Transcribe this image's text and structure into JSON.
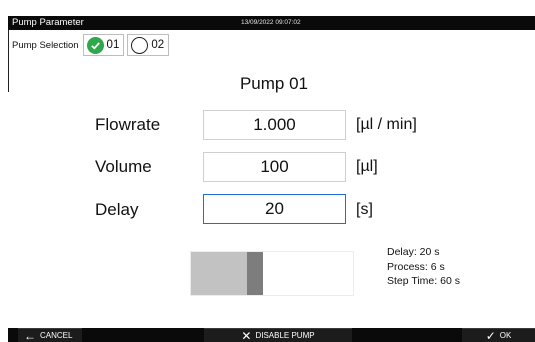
{
  "window": {
    "title": "Pump Parameter",
    "datetime": "13/09/2022 09:07:02"
  },
  "pump_selection": {
    "label": "Pump Selection",
    "options": [
      {
        "label": "01",
        "selected": true,
        "icon": "check-circle-icon"
      },
      {
        "label": "02",
        "selected": false,
        "icon": "empty-radio-icon"
      }
    ]
  },
  "pump_title": "Pump 01",
  "params": {
    "flowrate": {
      "label": "Flowrate",
      "value": "1.000",
      "unit": "[µl / min]"
    },
    "volume": {
      "label": "Volume",
      "value": "100",
      "unit": "[µl]"
    },
    "delay": {
      "label": "Delay",
      "value": "20",
      "unit": "[s]",
      "focused": true
    }
  },
  "timeline": {
    "delay_s": 20,
    "process_s": 6,
    "step_time_s": 60,
    "colors": {
      "delay": "#c2c2c2",
      "process": "#7d7d7d",
      "remaining": "#ffffff"
    }
  },
  "info": {
    "delay": "Delay: 20 s",
    "process": "Process: 6 s",
    "step_time": "Step Time: 60 s"
  },
  "buttons": {
    "cancel": {
      "label": "CANCEL",
      "icon": "arrow-left-icon"
    },
    "disable": {
      "label": "DISABLE PUMP",
      "icon": "x-icon"
    },
    "ok": {
      "label": "OK",
      "icon": "check-icon"
    }
  },
  "colors": {
    "bar_bg": "#0a0a0a",
    "selected_green": "#2ea84a",
    "focus_blue": "#1e6fd0"
  }
}
